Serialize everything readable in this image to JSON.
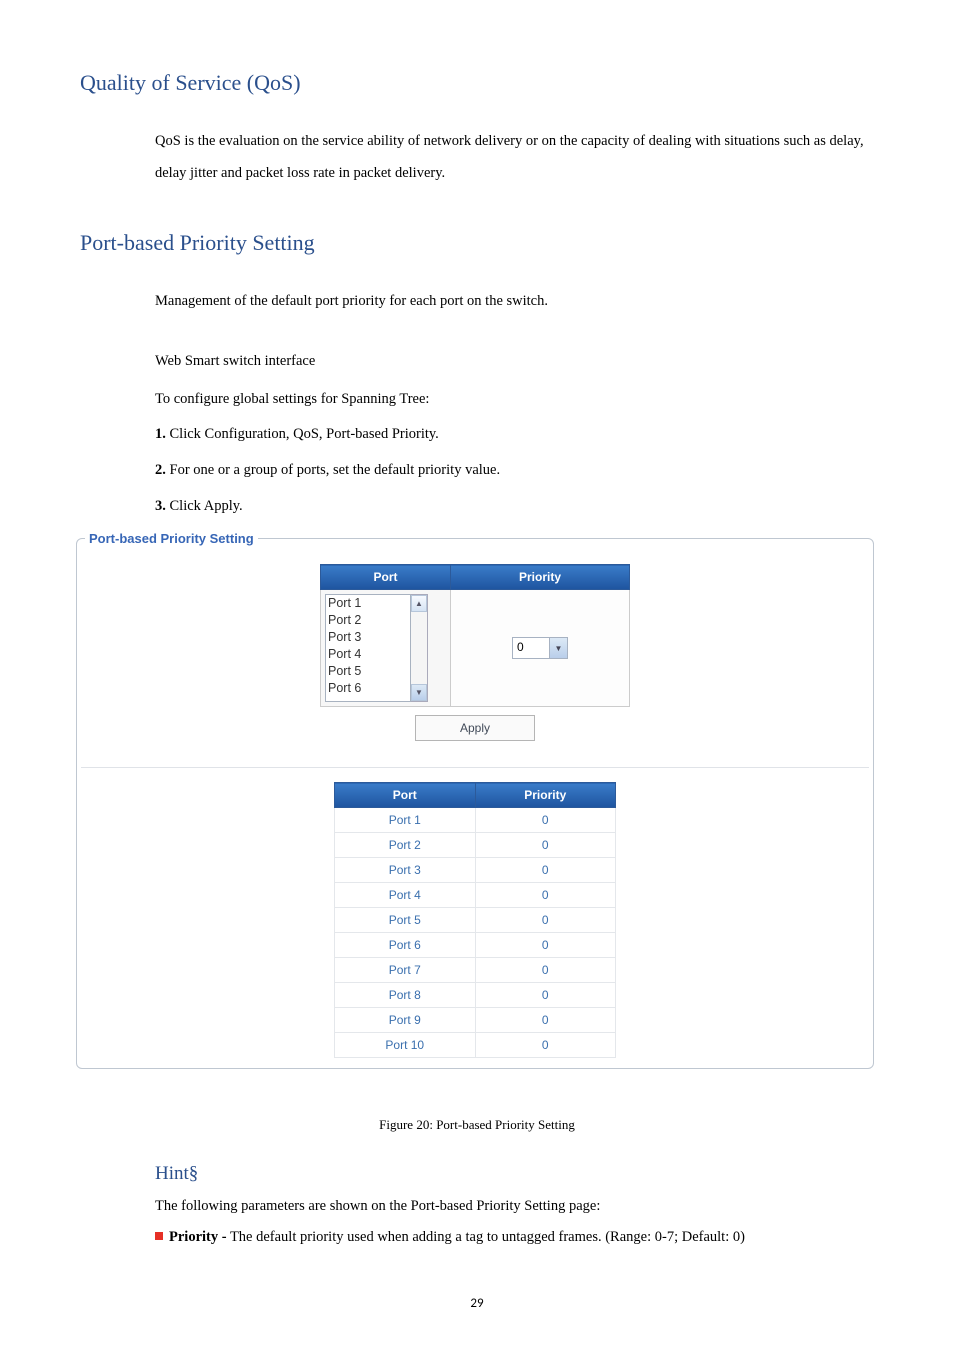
{
  "headings": {
    "qos": "Quality of Service (QoS)",
    "port_priority": "Port-based Priority Setting",
    "hint": "Hint§"
  },
  "paragraphs": {
    "qos_desc": "QoS is the evaluation on the service ability of network delivery or on the capacity of dealing with situations such as delay, delay jitter and packet loss rate in packet delivery.",
    "port_priority_desc": "Management of the default port priority for each port on the switch.",
    "interface_line": "Web Smart switch interface",
    "intro_line": "To configure global settings for Spanning Tree:",
    "step1_prefix": "1.",
    "step1_text": " Click Configuration, QoS, Port-based Priority.",
    "step2_prefix": "2.",
    "step2_text": " For one or a group of ports, set the default priority value.",
    "step3_prefix": "3.",
    "step3_text": " Click Apply.",
    "hint_intro": "The following parameters are shown on the Port-based Priority Setting page:",
    "priority_label": "Priority -",
    "priority_desc": " The default priority used when adding a tag to untagged frames. (Range: 0-7; Default: 0)"
  },
  "fieldset_legend": "Port-based Priority Setting",
  "config_table": {
    "headers": {
      "port": "Port",
      "priority": "Priority"
    },
    "listbox_items": [
      "Port 1",
      "Port 2",
      "Port 3",
      "Port 4",
      "Port 5",
      "Port 6"
    ],
    "priority_value": "0",
    "apply_label": "Apply"
  },
  "status_table": {
    "headers": {
      "port": "Port",
      "priority": "Priority"
    },
    "rows": [
      {
        "port": "Port 1",
        "priority": "0"
      },
      {
        "port": "Port 2",
        "priority": "0"
      },
      {
        "port": "Port 3",
        "priority": "0"
      },
      {
        "port": "Port 4",
        "priority": "0"
      },
      {
        "port": "Port 5",
        "priority": "0"
      },
      {
        "port": "Port 6",
        "priority": "0"
      },
      {
        "port": "Port 7",
        "priority": "0"
      },
      {
        "port": "Port 8",
        "priority": "0"
      },
      {
        "port": "Port 9",
        "priority": "0"
      },
      {
        "port": "Port 10",
        "priority": "0"
      }
    ]
  },
  "figure_caption": "Figure 20: Port-based Priority Setting",
  "page_number": "29"
}
